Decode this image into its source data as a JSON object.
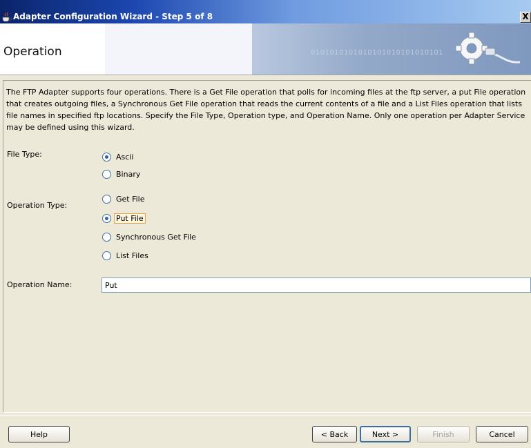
{
  "window": {
    "title": "Adapter Configuration Wizard - Step 5 of 8",
    "close_glyph": "X",
    "icon": "java-cup-icon"
  },
  "banner": {
    "step_title": "Operation",
    "binary_text": "0101010101010101010101010101",
    "graphic": "gear-plug-icon"
  },
  "description": "The FTP Adapter supports four operations.  There is a Get File operation that polls for incoming files at the ftp server, a put File operation that creates outgoing files, a Synchronous Get File operation that reads the current contents of a file and a List Files operation that lists file names in specified ftp locations.  Specify the File Type, Operation type, and Operation Name.  Only one operation per Adapter Service may be defined using this wizard.",
  "file_type": {
    "label": "File Type:",
    "options": [
      {
        "label": "Ascii",
        "checked": true
      },
      {
        "label": "Binary",
        "checked": false
      }
    ]
  },
  "operation_type": {
    "label": "Operation Type:",
    "options": [
      {
        "label": "Get File",
        "checked": false
      },
      {
        "label": "Put File",
        "checked": true
      },
      {
        "label": "Synchronous Get File",
        "checked": false
      },
      {
        "label": "List Files",
        "checked": false
      }
    ]
  },
  "operation_name": {
    "label": "Operation Name:",
    "value": "Put"
  },
  "buttons": {
    "help": "Help",
    "back": "< Back",
    "next": "Next >",
    "finish": "Finish",
    "cancel": "Cancel"
  },
  "colors": {
    "title_bar_start": "#0a246a",
    "dialog_bg": "#ece9d8",
    "focus_outline": "#f0a040"
  }
}
